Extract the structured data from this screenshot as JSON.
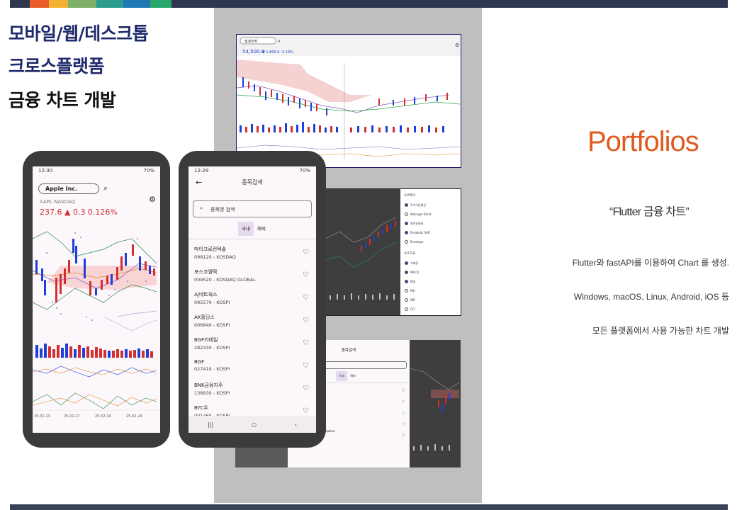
{
  "colors": {
    "accent_orange": "#e05a1e",
    "title_navy": "#1f2a6b",
    "bar_navy": "#2e3650",
    "up_red": "#d32f2f",
    "down_blue": "#1e3fd8"
  },
  "title": {
    "line1": "모바일/웹/데스크톱",
    "line2": "크로스플랫폼",
    "line3": "금융 차트 개발"
  },
  "right": {
    "heading": "Portfolios",
    "quote": "“Flutter 금융 차트”",
    "desc1": "Flutter와 fastAPI를 이용하여 Chart 를 생성.",
    "desc2": "Windows, macOS, Linux, Android, iOS 등",
    "desc3": "모든 플랫폼에서 사용 가능한 차트 개발"
  },
  "phone1": {
    "status_time": "12:30",
    "status_right": "70%",
    "search_value": "Apple Inc.",
    "ticker": "AAPL   NASDAQ",
    "price": "237.6  ▲ 0.3  0.126%",
    "date_labels": [
      "25-01-13",
      "25-01-27",
      "25-02-10",
      "25-02-24"
    ]
  },
  "phone2": {
    "status_time": "12:29",
    "status_right": "70%",
    "screen_title": "종목검색",
    "search_placeholder": "종목명 검색",
    "tabs": [
      "국내",
      "해외"
    ],
    "stocks": [
      {
        "name": "마이크로컨텍솔",
        "code": "098120 - KOSDAQ"
      },
      {
        "name": "포스코엠텍",
        "code": "009520 - KOSDAQ GLOBAL"
      },
      {
        "name": "AJ네트웍스",
        "code": "095570 - KOSPI"
      },
      {
        "name": "AK홀딩스",
        "code": "006840 - KOSPI"
      },
      {
        "name": "BGF리테일",
        "code": "282330 - KOSPI"
      },
      {
        "name": "BGF",
        "code": "027410 - KOSPI"
      },
      {
        "name": "BNK금융지주",
        "code": "138930 - KOSPI"
      },
      {
        "name": "BYC우",
        "code": "001465 - KOSPI"
      }
    ]
  },
  "shot1": {
    "search_value": "삼성전자",
    "price": "54,500.0",
    "change": "▼ 1,800.0  -3.19%"
  },
  "shot2": {
    "overlay_header": "오버레이",
    "overlay_items": [
      {
        "label": "주가이동평균",
        "checked": true
      },
      {
        "label": "Bollinger Band",
        "checked": false
      },
      {
        "label": "일목균형표",
        "checked": true
      },
      {
        "label": "Parabolic SAR",
        "checked": true
      },
      {
        "label": "Envelope",
        "checked": false
      }
    ],
    "aux_header": "보조지표",
    "aux_items": [
      {
        "label": "거래량",
        "checked": true
      },
      {
        "label": "MACD",
        "checked": true
      },
      {
        "label": "KDJ",
        "checked": true
      },
      {
        "label": "RSI",
        "checked": false
      },
      {
        "label": "WR",
        "checked": false
      },
      {
        "label": "CCI",
        "checked": false
      }
    ]
  },
  "shot3": {
    "title": "종목검색",
    "tabs": [
      "국내",
      "해외"
    ],
    "partial_text": "poration"
  }
}
